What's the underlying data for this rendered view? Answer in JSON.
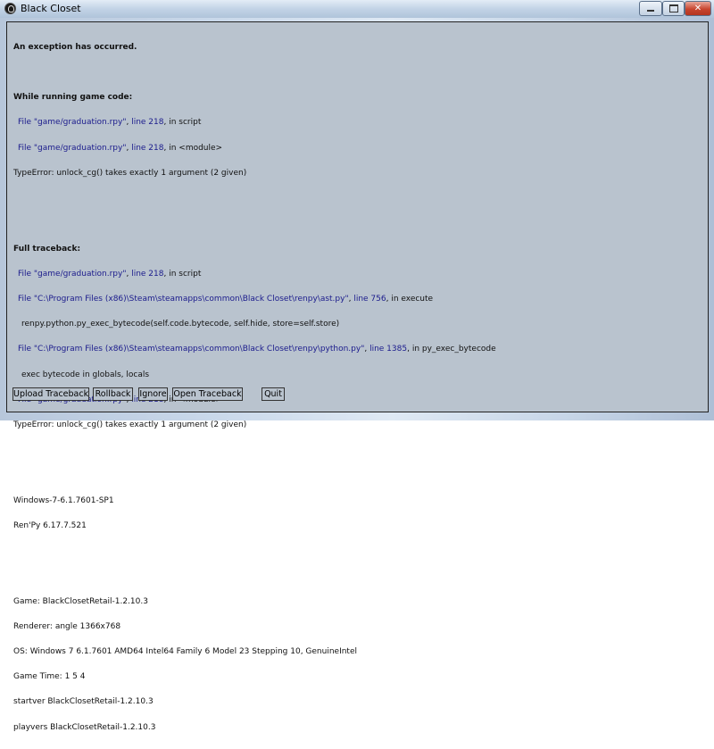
{
  "window": {
    "title": "Black Closet",
    "minimize_icon": "minimize-icon",
    "maximize_icon": "maximize-icon",
    "close_icon": "close-icon"
  },
  "error": {
    "heading": "An exception has occurred.",
    "game_code_heading": "While running game code:",
    "game_code": [
      {
        "file": "File \"game/graduation.rpy\"",
        "line": "line 218",
        "rest": ", in script"
      },
      {
        "file": "File \"game/graduation.rpy\"",
        "line": "line 218",
        "rest": ", in <module>"
      }
    ],
    "game_error": "TypeError: unlock_cg() takes exactly 1 argument (2 given)",
    "full_heading": "Full traceback:",
    "full_1": {
      "file": "File \"game/graduation.rpy\"",
      "line": "line 218",
      "rest": ", in script"
    },
    "full_2": {
      "file": "File \"C:\\Program Files (x86)\\Steam\\steamapps\\common\\Black Closet\\renpy\\ast.py\"",
      "line": "line 756",
      "rest": ", in execute"
    },
    "full_2_code": "renpy.python.py_exec_bytecode(self.code.bytecode, self.hide, store=self.store)",
    "full_3": {
      "file": "File \"C:\\Program Files (x86)\\Steam\\steamapps\\common\\Black Closet\\renpy\\python.py\"",
      "line": "line 1385",
      "rest": ", in py_exec_bytecode"
    },
    "full_3_code": "exec bytecode in globals, locals",
    "full_4": {
      "file": "File \"game/graduation.rpy\"",
      "line": "line 218",
      "rest": ", in <module>"
    },
    "full_error": "TypeError: unlock_cg() takes exactly 1 argument (2 given)"
  },
  "system": {
    "os_version": "Windows-7-6.1.7601-SP1",
    "renpy": "Ren'Py 6.17.7.521"
  },
  "info": {
    "game": "Game: BlackClosetRetail-1.2.10.3",
    "renderer": "Renderer: angle 1366x768",
    "os": "OS: Windows 7 6.1.7601 AMD64 Intel64 Family 6 Model 23 Stepping 10, GenuineIntel",
    "game_time": "Game Time: 1 5 4",
    "startver": "startver BlackClosetRetail-1.2.10.3",
    "playvers": "playvers BlackClosetRetail-1.2.10.3"
  },
  "buttons": {
    "upload": "Upload Traceback",
    "rollback": "Rollback",
    "ignore": "Ignore",
    "open": "Open Traceback",
    "quit": "Quit"
  },
  "colors": {
    "link": "#1b1b8c",
    "panel": "#b9c3ce"
  }
}
